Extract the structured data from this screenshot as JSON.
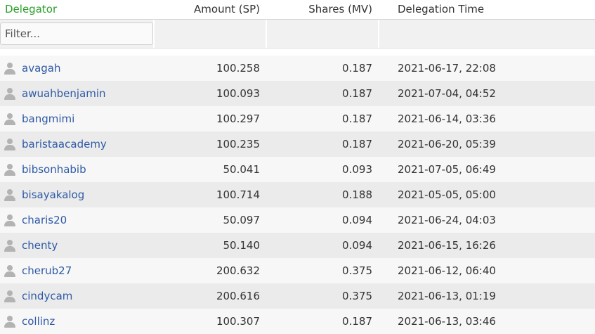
{
  "columns": {
    "delegator": "Delegator",
    "amount": "Amount (SP)",
    "shares": "Shares (MV)",
    "time": "Delegation Time"
  },
  "filter": {
    "placeholder": "Filter..."
  },
  "rows": [
    {
      "name": "avagah",
      "amount": "100.258",
      "shares": "0.187",
      "time": "2021-06-17, 22:08"
    },
    {
      "name": "awuahbenjamin",
      "amount": "100.093",
      "shares": "0.187",
      "time": "2021-07-04, 04:52"
    },
    {
      "name": "bangmimi",
      "amount": "100.297",
      "shares": "0.187",
      "time": "2021-06-14, 03:36"
    },
    {
      "name": "baristaacademy",
      "amount": "100.235",
      "shares": "0.187",
      "time": "2021-06-20, 05:39"
    },
    {
      "name": "bibsonhabib",
      "amount": "50.041",
      "shares": "0.093",
      "time": "2021-07-05, 06:49"
    },
    {
      "name": "bisayakalog",
      "amount": "100.714",
      "shares": "0.188",
      "time": "2021-05-05, 05:00"
    },
    {
      "name": "charis20",
      "amount": "50.097",
      "shares": "0.094",
      "time": "2021-06-24, 04:03"
    },
    {
      "name": "chenty",
      "amount": "50.140",
      "shares": "0.094",
      "time": "2021-06-15, 16:26"
    },
    {
      "name": "cherub27",
      "amount": "200.632",
      "shares": "0.375",
      "time": "2021-06-12, 06:40"
    },
    {
      "name": "cindycam",
      "amount": "200.616",
      "shares": "0.375",
      "time": "2021-06-13, 01:19"
    },
    {
      "name": "collinz",
      "amount": "100.307",
      "shares": "0.187",
      "time": "2021-06-13, 03:46"
    }
  ],
  "icons": {
    "row_icon": "user-icon"
  },
  "colors": {
    "delegator_header": "#2aa02a",
    "link": "#2f5aa6"
  }
}
